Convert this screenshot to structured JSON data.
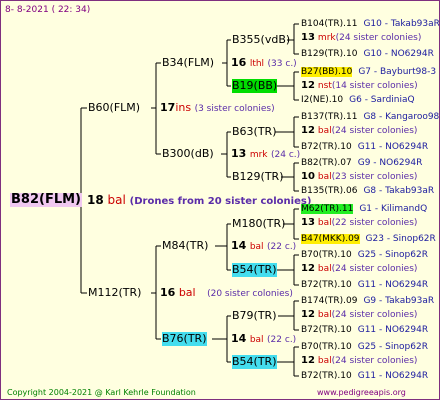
{
  "header": {
    "date": "8-  8-2021 ( 22: 34)"
  },
  "footer": {
    "copyright": "Copyright 2004-2021 @ Karl Kehrle Foundation",
    "site": "www.pedigreeapis.org"
  },
  "root": {
    "id": "B82(FLM)",
    "num": "18",
    "sp": "bal",
    "note": "(Drones from 20 sister colonies)"
  },
  "sire": {
    "id": "B60(FLM)",
    "num": "17",
    "sp": "ins",
    "note": "(3 sister colonies)"
  },
  "dam": {
    "id": "M112(TR)",
    "num": "16",
    "sp": "bal",
    "note": "(20 sister colonies)"
  },
  "sire_sire": {
    "id": "B34(FLM)",
    "num": "16",
    "sp": "lthl",
    "note": "(33 c.)"
  },
  "sire_dam": {
    "id": "B300(dB)",
    "num": "13",
    "sp": "mrk",
    "note": "(24 c.)"
  },
  "dam_sire": {
    "id": "M84(TR)",
    "num": "14",
    "sp": "bal",
    "note": "(22 c.)"
  },
  "dam_dam": {
    "id": "B76(TR)",
    "num": "14",
    "sp": "bal",
    "note": "(22 c.)"
  },
  "g3": [
    {
      "id": "B355(vdB)"
    },
    {
      "id": "B19(BB)"
    },
    {
      "id": "B63(TR)"
    },
    {
      "id": "B129(TR)"
    },
    {
      "id": "M180(TR)"
    },
    {
      "id": "B54(TR)"
    },
    {
      "id": "B79(TR)"
    },
    {
      "id": "B54(TR)"
    }
  ],
  "g4": [
    {
      "id": "B104(TR).11",
      "gt": "G10 - Takab93aR"
    },
    {
      "num": "13",
      "sp": "mrk",
      "note": "(24 sister colonies)"
    },
    {
      "id": "B129(TR).10",
      "gt": "G10 - NO6294R"
    },
    {
      "id": "B27(BB).10",
      "gt": "G7 - Bayburt98-3"
    },
    {
      "num": "12",
      "sp": "nst",
      "note": "(14 sister colonies)"
    },
    {
      "id": "I2(NE).10",
      "gt": "G6 - SardiniaQ"
    },
    {
      "id": "B137(TR).11",
      "gt": "G8 - Kangaroo98R"
    },
    {
      "num": "12",
      "sp": "bal",
      "note": "(24 sister colonies)"
    },
    {
      "id": "B72(TR).10",
      "gt": "G11 - NO6294R"
    },
    {
      "id": "B82(TR).07",
      "gt": "G9 - NO6294R"
    },
    {
      "num": "10",
      "sp": "bal",
      "note": "(23 sister colonies)"
    },
    {
      "id": "B135(TR).06",
      "gt": "G8 - Takab93aR"
    },
    {
      "id": "M62(TR).11",
      "gt": "G1 - KilimandQ"
    },
    {
      "num": "13",
      "sp": "bal",
      "note": "(22 sister colonies)"
    },
    {
      "id": "B47(MKK).09",
      "gt": "G23 - Sinop62R"
    },
    {
      "id": "B70(TR).10",
      "gt": "G25 - Sinop62R"
    },
    {
      "num": "12",
      "sp": "bal",
      "note": "(24 sister colonies)"
    },
    {
      "id": "B72(TR).10",
      "gt": "G11 - NO6294R"
    },
    {
      "id": "B174(TR).09",
      "gt": "G9 - Takab93aR"
    },
    {
      "num": "12",
      "sp": "bal",
      "note": "(24 sister colonies)"
    },
    {
      "id": "B72(TR).10",
      "gt": "G11 - NO6294R"
    },
    {
      "id": "B70(TR).10",
      "gt": "G25 - Sinop62R"
    },
    {
      "num": "12",
      "sp": "bal",
      "note": "(24 sister colonies)"
    },
    {
      "id": "B72(TR).10",
      "gt": "G11 - NO6294R"
    }
  ]
}
